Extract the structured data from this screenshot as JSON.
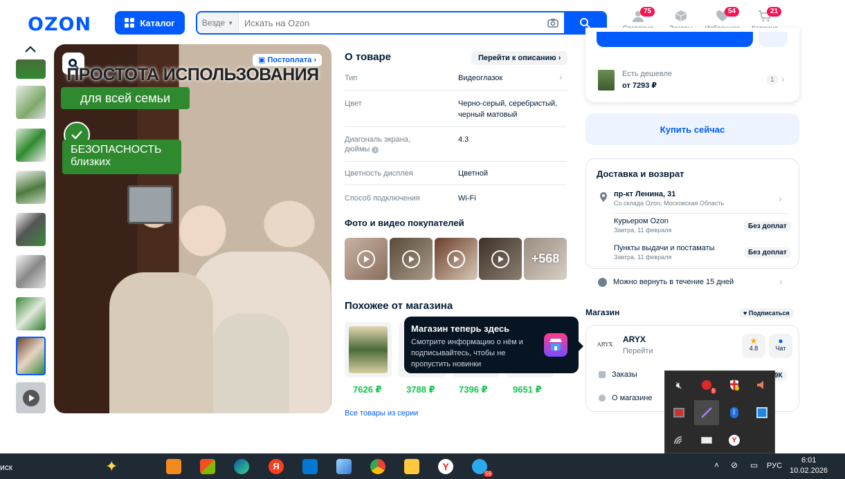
{
  "header": {
    "logo": "OZON",
    "catalog_label": "Каталог",
    "search_scope": "Везде",
    "search_placeholder": "Искать на Ozon",
    "nav": [
      {
        "label": "Светлана",
        "badge": "75"
      },
      {
        "label": "Заказы",
        "badge": ""
      },
      {
        "label": "Избранное",
        "badge": "54"
      },
      {
        "label": "Корзина",
        "badge": "21"
      }
    ]
  },
  "gallery": {
    "title_line1": "ПРОСТОТА ИСПОЛЬЗОВАНИЯ",
    "title_line2": "для всей семьи",
    "safe_line1": "БЕЗОПАСНОСТЬ",
    "safe_line2": "близких",
    "postpay": "Постоплата"
  },
  "about": {
    "title": "О товаре",
    "goto": "Перейти к описанию",
    "rows": [
      {
        "key": "Тип",
        "value": "Видеоглазок"
      },
      {
        "key": "Цвет",
        "value": "Черно-серый, серебристый, черный матовый"
      },
      {
        "key": "Диагональ экрана, дюймы",
        "value": "4.3"
      },
      {
        "key": "Цветность дисплея",
        "value": "Цветной"
      },
      {
        "key": "Способ подключения",
        "value": "Wi-Fi"
      }
    ]
  },
  "media": {
    "title": "Фото и видео покупателей",
    "more": "+568"
  },
  "similar": {
    "title": "Похожее от магазина",
    "prices": [
      "7626 ₽",
      "3788 ₽",
      "7396 ₽",
      "9651 ₽"
    ],
    "series_link": "Все товары из серии"
  },
  "tooltip": {
    "title": "Магазин теперь здесь",
    "text": "Смотрите информацию о нём и подписывайтесь, чтобы не пропустить новинки"
  },
  "buy": {
    "cheaper_label": "Есть дешевле",
    "cheaper_price": "от 7293 ₽",
    "cheaper_count": "1",
    "buy_now": "Купить сейчас"
  },
  "delivery": {
    "title": "Доставка и возврат",
    "address": "пр-кт Ленина, 31",
    "address_sub": "Со склада Ozon, Московская Область",
    "options": [
      {
        "name": "Курьером Ozon",
        "date": "Завтра, 11 февраля",
        "tag": "Без доплат"
      },
      {
        "name": "Пункты выдачи и постаматы",
        "date": "Завтра, 11 февраля",
        "tag": "Без доплат"
      }
    ],
    "return": "Можно вернуть в течение 15 дней"
  },
  "shop": {
    "title": "Магазин",
    "subscribe": "Подписаться",
    "name": "ARYX",
    "logo_text": "ARYX",
    "goto": "Перейти",
    "rating": "4.8",
    "chat": "Чат",
    "orders": "Заказы",
    "orders_count": "9К",
    "about": "О магазине"
  },
  "taskbar": {
    "left_text": "иск",
    "lang": "РУС",
    "time": "6:01",
    "date": "10.02.2026",
    "telegram_badge": "59"
  },
  "tray": {
    "antivirus_badge": "9"
  }
}
